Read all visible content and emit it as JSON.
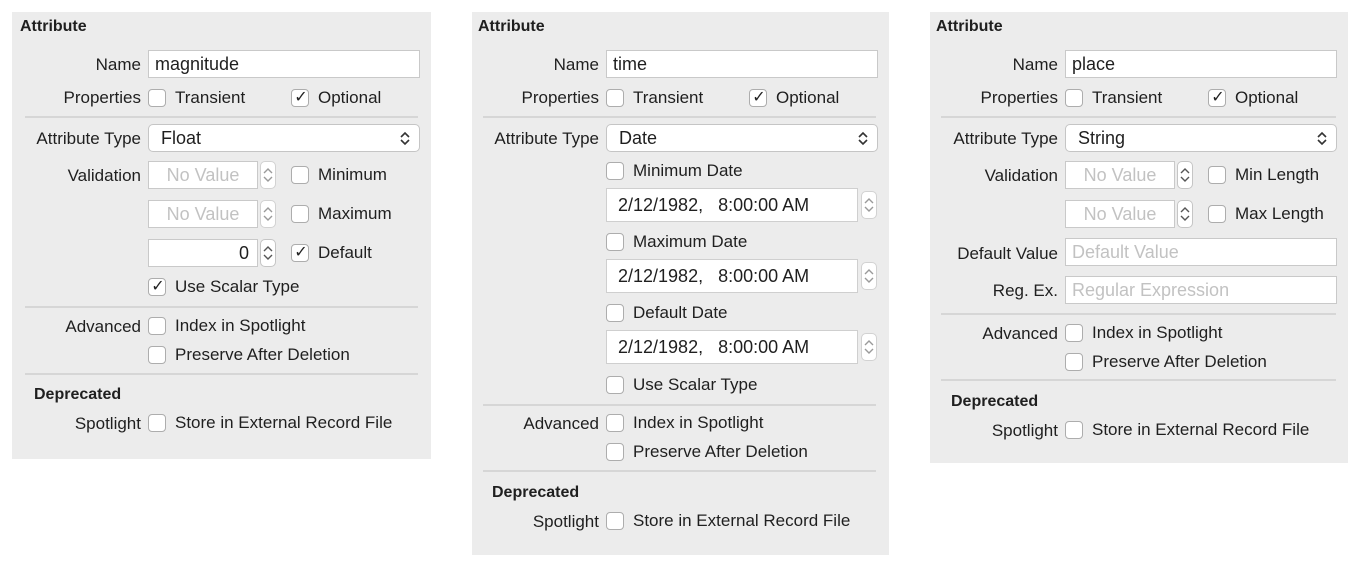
{
  "panels": [
    {
      "section_title": "Attribute",
      "name_label": "Name",
      "name_value": "magnitude",
      "properties_label": "Properties",
      "transient_label": "Transient",
      "transient_checked": false,
      "optional_label": "Optional",
      "optional_checked": true,
      "attribute_type_label": "Attribute Type",
      "attribute_type_value": "Float",
      "validation_label": "Validation",
      "minimum_placeholder": "No Value",
      "minimum_label": "Minimum",
      "minimum_checked": false,
      "maximum_placeholder": "No Value",
      "maximum_label": "Maximum",
      "maximum_checked": false,
      "default_value": "0",
      "default_label": "Default",
      "default_checked": true,
      "scalar_label": "Use Scalar Type",
      "scalar_checked": true,
      "advanced_label": "Advanced",
      "index_label": "Index in Spotlight",
      "index_checked": false,
      "preserve_label": "Preserve After Deletion",
      "preserve_checked": false,
      "deprecated_title": "Deprecated",
      "spotlight_label": "Spotlight",
      "store_label": "Store in External Record File",
      "store_checked": false
    },
    {
      "section_title": "Attribute",
      "name_label": "Name",
      "name_value": "time",
      "properties_label": "Properties",
      "transient_label": "Transient",
      "transient_checked": false,
      "optional_label": "Optional",
      "optional_checked": true,
      "attribute_type_label": "Attribute Type",
      "attribute_type_value": "Date",
      "min_date_label": "Minimum Date",
      "min_date_checked": false,
      "min_date_value": "2/12/1982,   8:00:00 AM",
      "max_date_label": "Maximum Date",
      "max_date_checked": false,
      "max_date_value": "2/12/1982,   8:00:00 AM",
      "default_date_label": "Default Date",
      "default_date_checked": false,
      "default_date_value": "2/12/1982,   8:00:00 AM",
      "scalar_label": "Use Scalar Type",
      "scalar_checked": false,
      "advanced_label": "Advanced",
      "index_label": "Index in Spotlight",
      "index_checked": false,
      "preserve_label": "Preserve After Deletion",
      "preserve_checked": false,
      "deprecated_title": "Deprecated",
      "spotlight_label": "Spotlight",
      "store_label": "Store in External Record File",
      "store_checked": false
    },
    {
      "section_title": "Attribute",
      "name_label": "Name",
      "name_value": "place",
      "properties_label": "Properties",
      "transient_label": "Transient",
      "transient_checked": false,
      "optional_label": "Optional",
      "optional_checked": true,
      "attribute_type_label": "Attribute Type",
      "attribute_type_value": "String",
      "validation_label": "Validation",
      "min_length_placeholder": "No Value",
      "min_length_label": "Min Length",
      "min_length_checked": false,
      "max_length_placeholder": "No Value",
      "max_length_label": "Max Length",
      "max_length_checked": false,
      "default_value_label": "Default Value",
      "default_value_placeholder": "Default Value",
      "regex_label": "Reg. Ex.",
      "regex_placeholder": "Regular Expression",
      "advanced_label": "Advanced",
      "index_label": "Index in Spotlight",
      "index_checked": false,
      "preserve_label": "Preserve After Deletion",
      "preserve_checked": false,
      "deprecated_title": "Deprecated",
      "spotlight_label": "Spotlight",
      "store_label": "Store in External Record File",
      "store_checked": false
    }
  ],
  "icons": {
    "popup_arrows": "chevron-up-down-icon",
    "stepper": "stepper-arrows-icon",
    "checkmark": "✓"
  }
}
